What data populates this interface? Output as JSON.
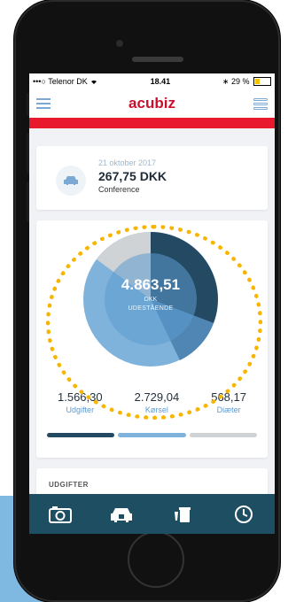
{
  "status_bar": {
    "carrier": "•••○ Telenor DK",
    "time": "18.41",
    "battery": "29 %"
  },
  "header": {
    "logo": "acubiz"
  },
  "expense": {
    "date": "21 oktober 2017",
    "amount": "267,75 DKK",
    "category": "Conference"
  },
  "summary": {
    "total": "4.863,51",
    "currency": "DKK",
    "label": "UDESTÅENDE",
    "stats": [
      {
        "value": "1.566,30",
        "label": "Udgifter"
      },
      {
        "value": "2.729,04",
        "label": "Kørsel"
      },
      {
        "value": "568,17",
        "label": "Diæter"
      }
    ]
  },
  "bottom_card": {
    "label": "UDGIFTER"
  },
  "tabbar": {
    "items": [
      "camera-icon",
      "car-icon",
      "food-drink-icon",
      "clock-icon"
    ]
  },
  "colors": {
    "brand_red": "#e8192c",
    "tabbar": "#1e4e62",
    "highlight": "#f7b500"
  }
}
